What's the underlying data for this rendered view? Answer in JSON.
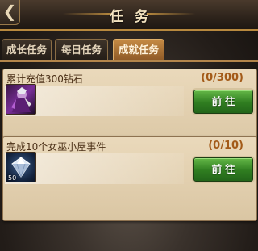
{
  "header": {
    "back_icon": "❮",
    "title": "任务"
  },
  "tabs": [
    {
      "label": "成长任务",
      "active": false
    },
    {
      "label": "每日任务",
      "active": false
    },
    {
      "label": "成就任务",
      "active": true
    }
  ],
  "tasks": [
    {
      "title": "累计充值300钻石",
      "progress": "(0/300)",
      "reward_icon": "gift-icon",
      "reward_qty": "",
      "button_label": "前往"
    },
    {
      "title": "完成10个女巫小屋事件",
      "progress": "(0/10)",
      "reward_icon": "diamond-icon",
      "reward_qty": "50",
      "button_label": "前往"
    }
  ],
  "colors": {
    "accent_gold": "#b8893e",
    "active_tab": "#c58a44",
    "button_green": "#2f7d20",
    "progress_text": "#a35a18"
  }
}
